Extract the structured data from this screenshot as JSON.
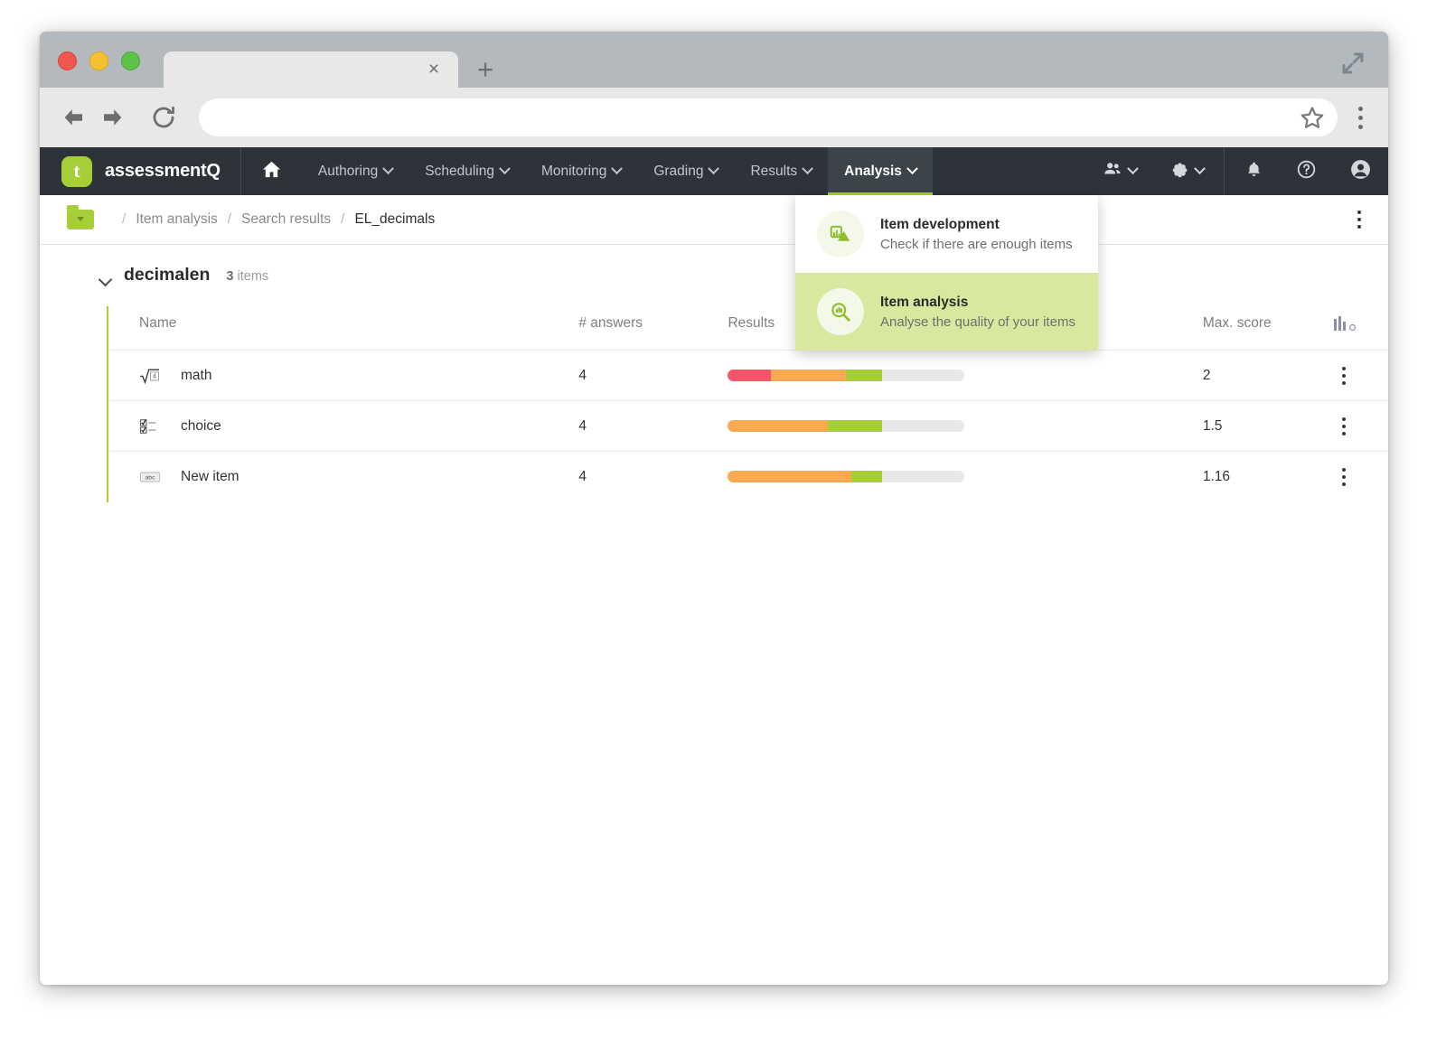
{
  "browser": {
    "tab_title": "",
    "url_value": "",
    "url_placeholder": "",
    "close_tab_label": "×",
    "new_tab_label": "+"
  },
  "navbar": {
    "brand_mark": "t",
    "brand_name": "assessmentQ",
    "items": [
      {
        "label": "Authoring",
        "active": false
      },
      {
        "label": "Scheduling",
        "active": false
      },
      {
        "label": "Monitoring",
        "active": false
      },
      {
        "label": "Grading",
        "active": false
      },
      {
        "label": "Results",
        "active": false
      },
      {
        "label": "Analysis",
        "active": true
      }
    ],
    "accent_color": "#a6ce39",
    "background_color": "#2d3338"
  },
  "analysis_menu": {
    "items": [
      {
        "title": "Item development",
        "subtitle": "Check if there are enough items",
        "icon": "bar-chart-triangle-icon",
        "selected": false
      },
      {
        "title": "Item analysis",
        "subtitle": "Analyse the quality of your items",
        "icon": "magnifier-chart-icon",
        "selected": true
      }
    ],
    "highlight_color": "#d9e89f"
  },
  "breadcrumb": {
    "folder_icon": "folder-dropdown-icon",
    "separator": "/",
    "items": [
      {
        "label": "Item analysis",
        "current": false
      },
      {
        "label": "Search results",
        "current": false
      },
      {
        "label": "EL_decimals",
        "current": true
      }
    ]
  },
  "group": {
    "title": "decimalen",
    "count_number": "3",
    "count_unit": "items"
  },
  "table": {
    "columns": [
      "Name",
      "# answers",
      "Results",
      "Max. score"
    ],
    "settings_icon": "column-settings-icon",
    "rows": [
      {
        "name": "math",
        "type_icon": "math-sqrt-icon",
        "answers": "4",
        "max_score": "2",
        "results": [
          {
            "color": "#f4556b",
            "start": 0,
            "end": 18
          },
          {
            "color": "#f9a köln",
            "start": 18,
            "end": 50
          },
          {
            "color": "#a6ce39",
            "start": 50,
            "end": 65
          }
        ]
      },
      {
        "name": "choice",
        "type_icon": "multiple-choice-icon",
        "answers": "4",
        "max_score": "1.5",
        "results": [
          {
            "color": "#f9a94f",
            "start": 0,
            "end": 42
          },
          {
            "color": "#a6ce39",
            "start": 42,
            "end": 65
          }
        ]
      },
      {
        "name": "New item",
        "type_icon": "abc-text-icon",
        "answers": "4",
        "max_score": "1.16",
        "results": [
          {
            "color": "#f9a94f",
            "start": 0,
            "end": 52
          },
          {
            "color": "#a6ce39",
            "start": 52,
            "end": 65
          }
        ]
      }
    ],
    "bar_track_color": "#e8e8e8",
    "red_color": "#f4556b",
    "orange_color": "#f9a94f",
    "green_color": "#a6ce39"
  }
}
